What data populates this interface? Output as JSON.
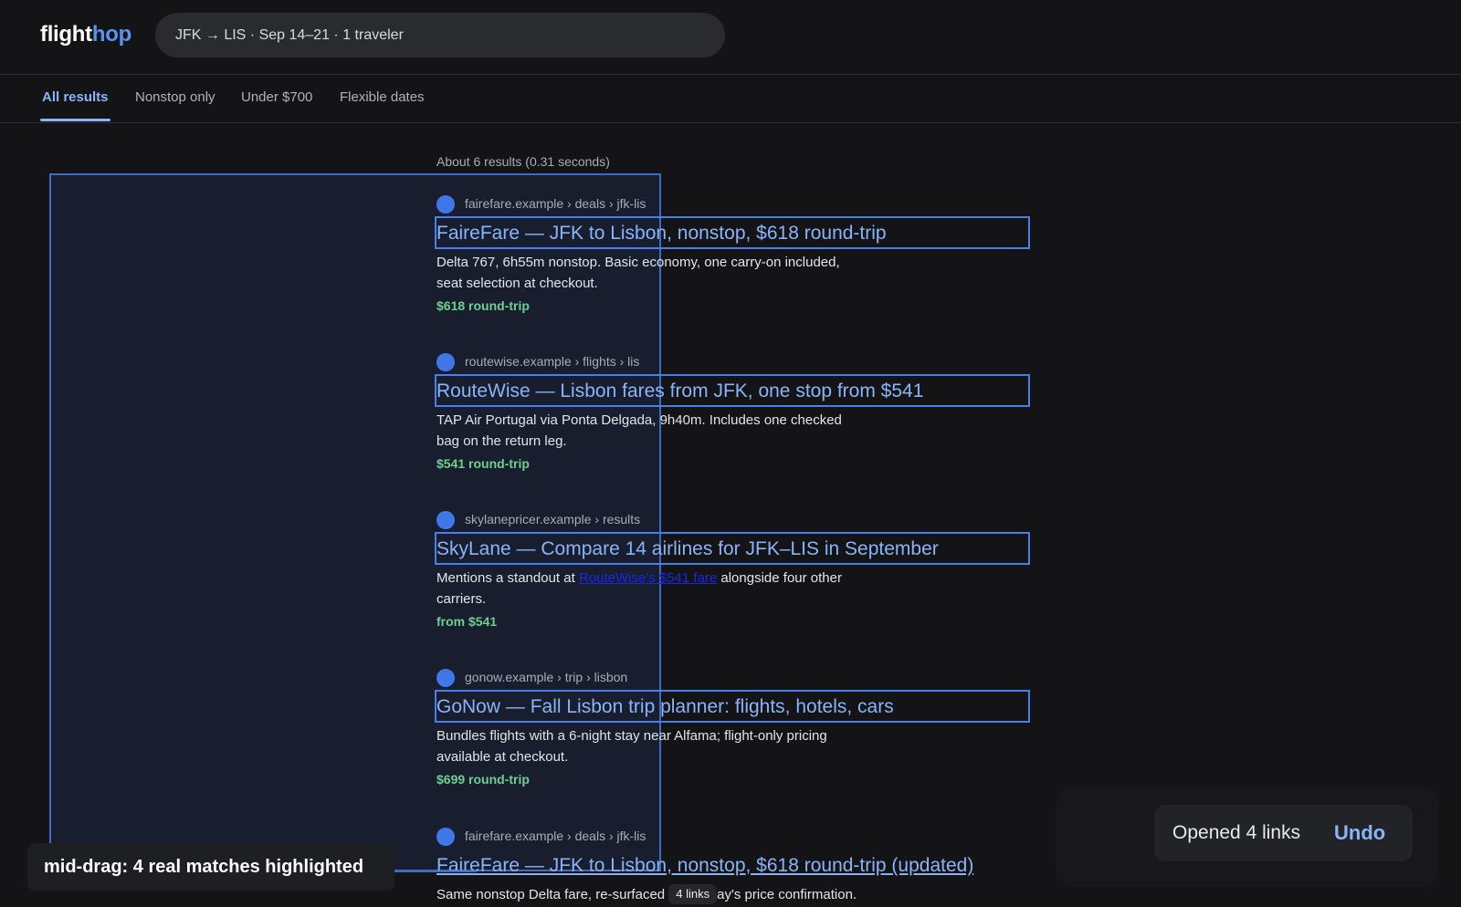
{
  "header": {
    "logo_main": "flight",
    "logo_accent": "hop",
    "search_query": "JFK → LIS · Sep 14–21 · 1 traveler"
  },
  "tabs": [
    {
      "label": "All results",
      "active": true
    },
    {
      "label": "Nonstop only",
      "active": false
    },
    {
      "label": "Under $700",
      "active": false
    },
    {
      "label": "Flexible dates",
      "active": false
    }
  ],
  "results_stats": "About 6 results (0.31 seconds)",
  "results": [
    {
      "breadcrumb": "fairefare.example › deals › jfk-lis",
      "title": "FaireFare — JFK to Lisbon, nonstop, $618 round-trip",
      "snippet": "Delta 767, 6h55m nonstop. Basic economy, one carry-on included, seat selection at checkout.",
      "price": "$618 round-trip",
      "highlighted": true
    },
    {
      "breadcrumb": "routewise.example › flights › lis",
      "title": "RouteWise — Lisbon fares from JFK, one stop from $541",
      "snippet": "TAP Air Portugal via Ponta Delgada, 9h40m. Includes one checked bag on the return leg.",
      "price": "$541 round-trip",
      "highlighted": true
    },
    {
      "breadcrumb": "skylanepricer.example › results",
      "title": "SkyLane — Compare 14 airlines for JFK–LIS in September",
      "snippet_before": "Mentions a standout at ",
      "snippet_link": "RouteWise's $541 fare",
      "snippet_after": " alongside four other carriers.",
      "price": "from $541",
      "highlighted": true
    },
    {
      "breadcrumb": "gonow.example › trip › lisbon",
      "title": "GoNow — Fall Lisbon trip planner: flights, hotels, cars",
      "snippet": "Bundles flights with a 6-night stay near Alfama; flight-only pricing available at checkout.",
      "price": "$699 round-trip",
      "highlighted": true
    },
    {
      "breadcrumb": "fairefare.example › deals › jfk-lis",
      "title": "FaireFare — JFK to Lisbon, nonstop, $618 round-trip (updated)",
      "snippet_before": "Same nonstop Delta fare, re-surfaced ",
      "snippet_after": "ay's price confirmation.",
      "highlighted": false
    }
  ],
  "drag_badge": "4 links",
  "toast": {
    "message": "Opened 4 links",
    "undo_label": "Undo"
  },
  "caption": "mid-drag: 4 real matches highlighted",
  "colors": {
    "background": "#141417",
    "link": "#8ab4f8",
    "price": "#6fcf8f",
    "selection_border": "#3f6bc1",
    "favicon": "#3f77e8"
  }
}
